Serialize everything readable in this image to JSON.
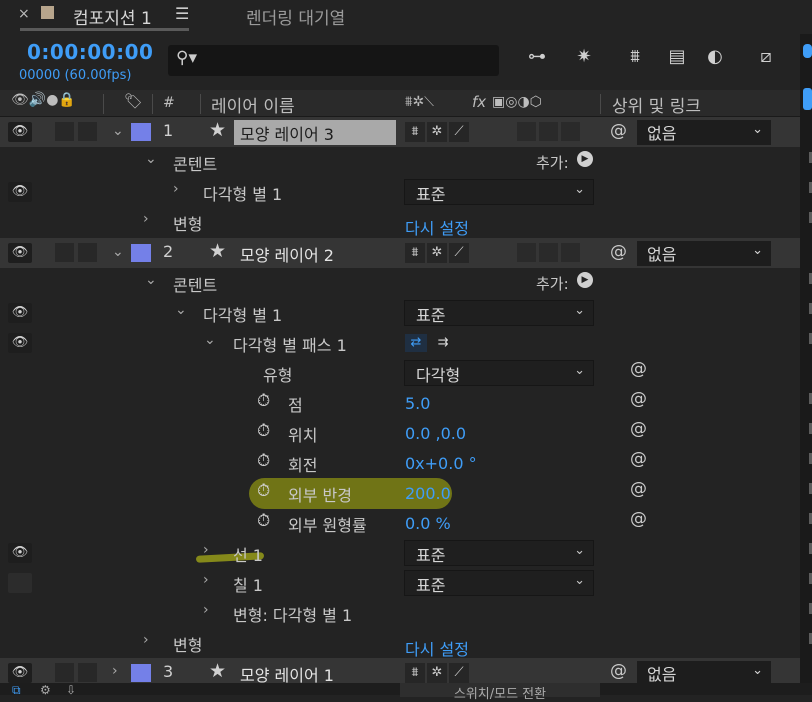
{
  "tabs": {
    "active_title": "컴포지션 1",
    "menu_icon": "hamburger-icon",
    "other_title": "렌더링 대기열",
    "close": "×"
  },
  "time": {
    "timecode": "0:00:00:00",
    "frames": "00000 (60.00fps)"
  },
  "header": {
    "layer_name": "레이어 이름",
    "num": "#",
    "fx": "fx",
    "parent_link": "상위 및 링크"
  },
  "layers": [
    {
      "num": "1",
      "name": "모양 레이어 3",
      "parent": "없음"
    },
    {
      "num": "2",
      "name": "모양 레이어 2",
      "parent": "없음"
    },
    {
      "num": "3",
      "name": "모양 레이어 1",
      "parent": "없음"
    }
  ],
  "rows": {
    "content": "콘텐트",
    "add": "추가:",
    "polystar": "다각형 별 1",
    "blend_normal": "표준",
    "transform": "변형",
    "reset": "다시 설정",
    "polystar_path": "다각형 별 패스 1",
    "type_label": "유형",
    "type_value": "다각형",
    "points_label": "점",
    "points_value": "5.0",
    "position_label": "위치",
    "position_value": "0.0 ,0.0",
    "rotation_label": "회전",
    "rotation_value": "0x+0.0 °",
    "outer_radius_label": "외부 반경",
    "outer_radius_value": "200.0",
    "outer_round_label": "외부 원형률",
    "outer_round_value": "0.0 %",
    "stroke": "선 1",
    "fill": "칠 1",
    "transform_polystar": "변형: 다각형 별 1"
  },
  "footer": {
    "toggle": "스위치/모드 전환"
  },
  "colors": {
    "accent": "#3f9df7",
    "label": "#7480e8",
    "highlight": "#7e8314"
  }
}
